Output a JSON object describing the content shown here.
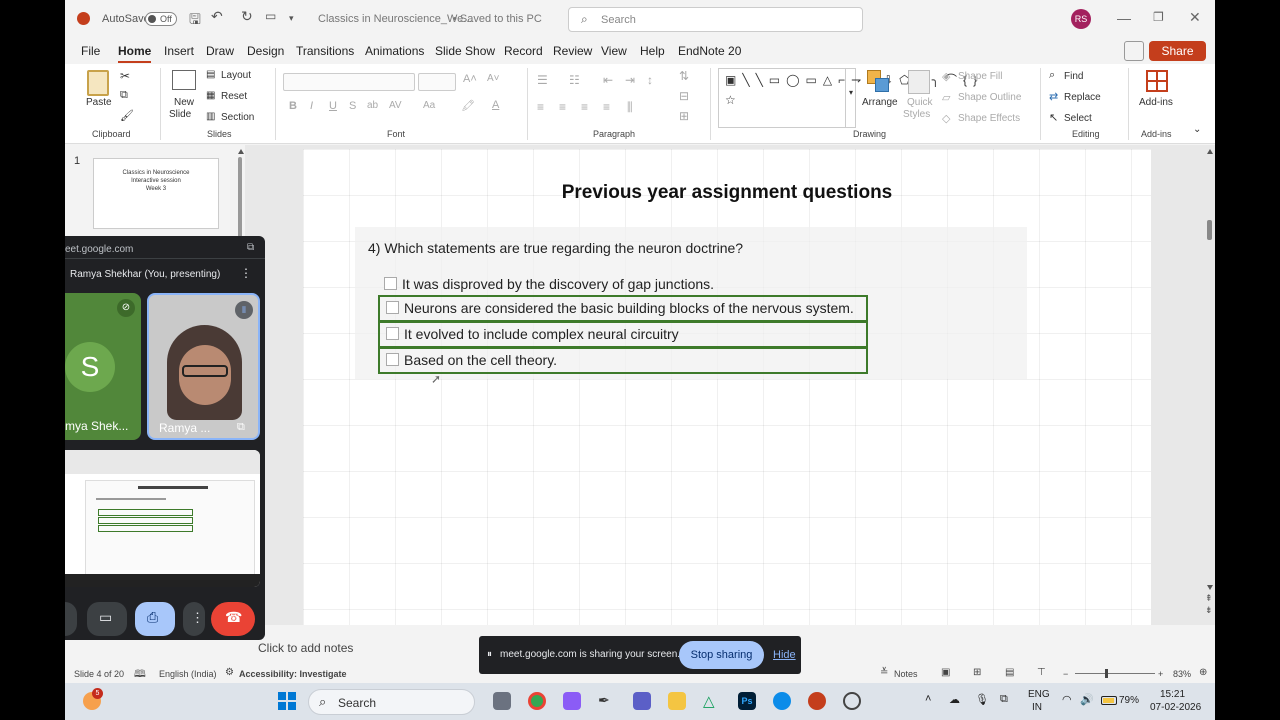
{
  "titlebar": {
    "autosave_label": "AutoSave",
    "autosave_state": "Off",
    "doc_title": "Classics in Neuroscience_We...",
    "save_status": "• Saved to this PC",
    "search_placeholder": "Search",
    "user_initials": "RS"
  },
  "menu": {
    "items": [
      "File",
      "Home",
      "Insert",
      "Draw",
      "Design",
      "Transitions",
      "Animations",
      "Slide Show",
      "Record",
      "Review",
      "View",
      "Help",
      "EndNote 20"
    ],
    "share_label": "Share"
  },
  "ribbon": {
    "clipboard": {
      "paste": "Paste",
      "label": "Clipboard"
    },
    "slides": {
      "new_slide": "New",
      "new_slide2": "Slide",
      "layout": "Layout",
      "reset": "Reset",
      "section": "Section",
      "label": "Slides"
    },
    "font": {
      "label": "Font"
    },
    "paragraph": {
      "label": "Paragraph"
    },
    "drawing": {
      "arrange": "Arrange",
      "quick_styles": "Quick",
      "quick_styles2": "Styles",
      "shape_fill": "Shape Fill",
      "shape_outline": "Shape Outline",
      "shape_effects": "Shape Effects",
      "label": "Drawing"
    },
    "editing": {
      "find": "Find",
      "replace": "Replace",
      "select": "Select",
      "label": "Editing"
    },
    "addins": {
      "addins": "Add-ins",
      "label": "Add-ins"
    }
  },
  "thumbnails": {
    "slide_number": "1",
    "thumb_title": "Classics in Neuroscience",
    "thumb_subtitle": "Interactive session",
    "thumb_week": "Week 3"
  },
  "slide": {
    "title": "Previous year assignment questions",
    "question": "4)    Which statements are true regarding the neuron doctrine?",
    "options": [
      "It was disproved by the discovery of gap junctions.",
      "Neurons are considered the basic building blocks of the nervous system.",
      "It evolved to include complex neural circuitry",
      "Based on the cell theory."
    ]
  },
  "notes": {
    "placeholder": "Click to add notes"
  },
  "status": {
    "slide_count": "Slide 4 of 20",
    "language": "English (India)",
    "accessibility": "Accessibility: Investigate",
    "notes_label": "Notes",
    "zoom": "83%"
  },
  "share_banner": {
    "message": "meet.google.com is sharing your screen.",
    "stop_label": "Stop sharing",
    "hide_label": "Hide"
  },
  "meet": {
    "url": "eet.google.com",
    "presenter": "Ramya Shekhar (You, presenting)",
    "tile1_initial": "S",
    "tile1_label": "mya Shek...",
    "tile2_label": "Ramya ..."
  },
  "taskbar": {
    "search_label": "Search",
    "notif_count": "5",
    "lang_top": "ENG",
    "lang_bottom": "IN",
    "battery": "79%",
    "time": "15:21",
    "date": "07-02-2026"
  },
  "colors": {
    "accent": "#c43e1c",
    "option_border": "#3d7a2a",
    "meet_bg": "#202124",
    "stop_btn": "#a8c7fa"
  }
}
